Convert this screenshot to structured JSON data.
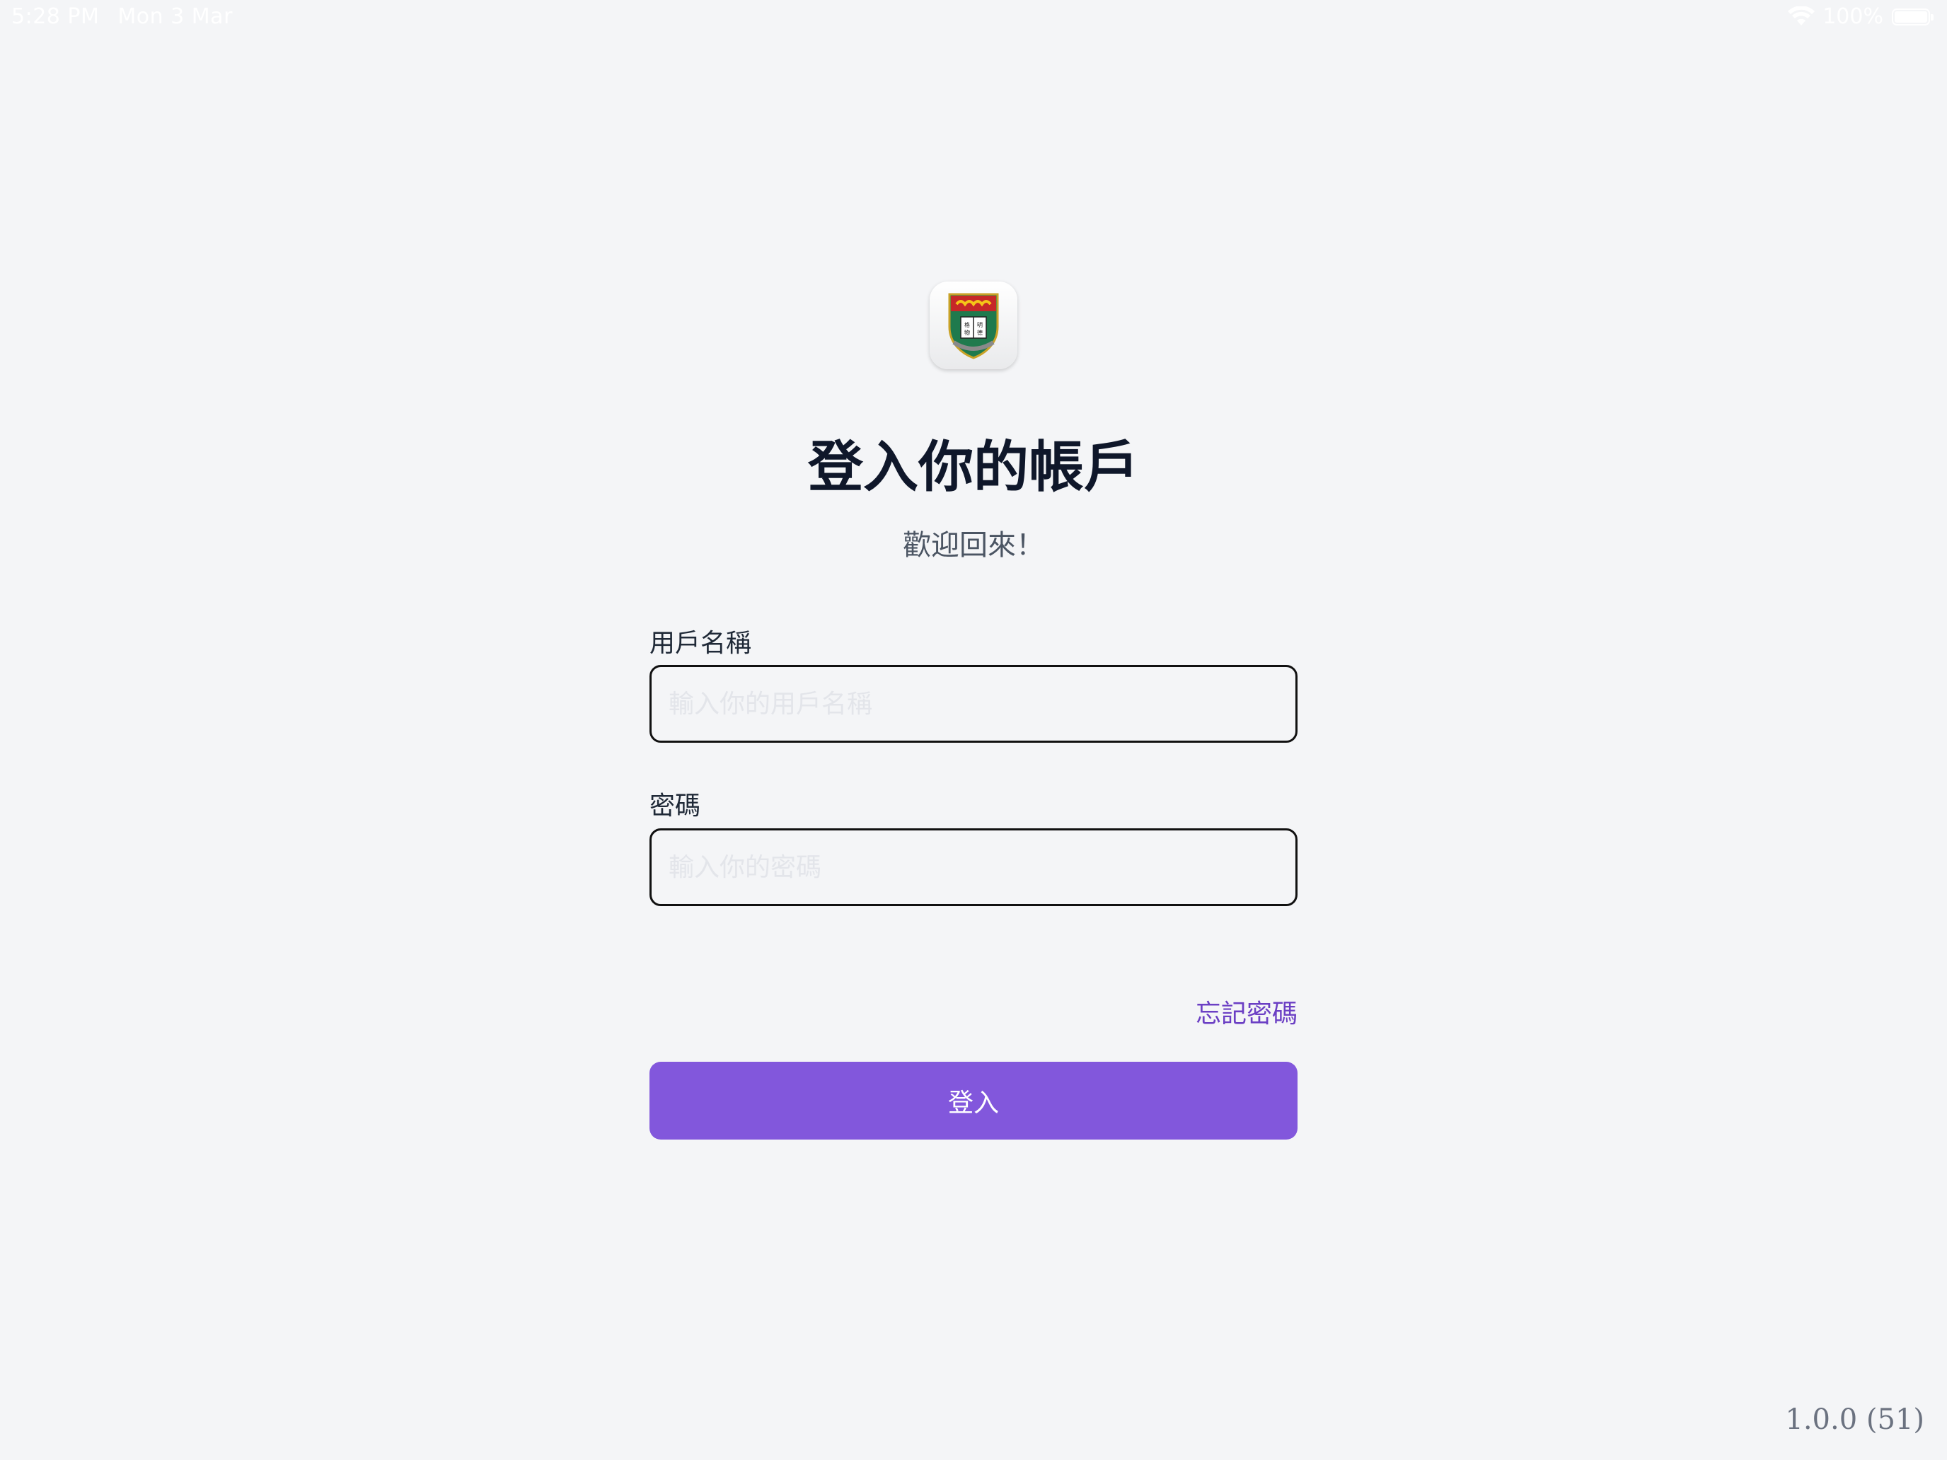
{
  "status_bar": {
    "time": "5:28 PM",
    "date": "Mon 3 Mar",
    "battery_percent": "100%",
    "wifi_icon": "wifi-icon",
    "battery_icon": "battery-icon"
  },
  "logo": {
    "icon": "university-crest-icon"
  },
  "header": {
    "title": "登入你的帳戶",
    "subtitle": "歡迎回來！"
  },
  "form": {
    "username_label": "用戶名稱",
    "username_value": "",
    "username_placeholder": "輸入你的用戶名稱",
    "password_label": "密碼",
    "password_value": "",
    "password_placeholder": "輸入你的密碼",
    "forgot_password": "忘記密碼",
    "submit_label": "登入"
  },
  "footer": {
    "version": "1.0.0 (51)"
  },
  "colors": {
    "background": "#f4f5f7",
    "accent": "#8257dc",
    "link": "#6b3fc4",
    "title": "#0f172a"
  }
}
